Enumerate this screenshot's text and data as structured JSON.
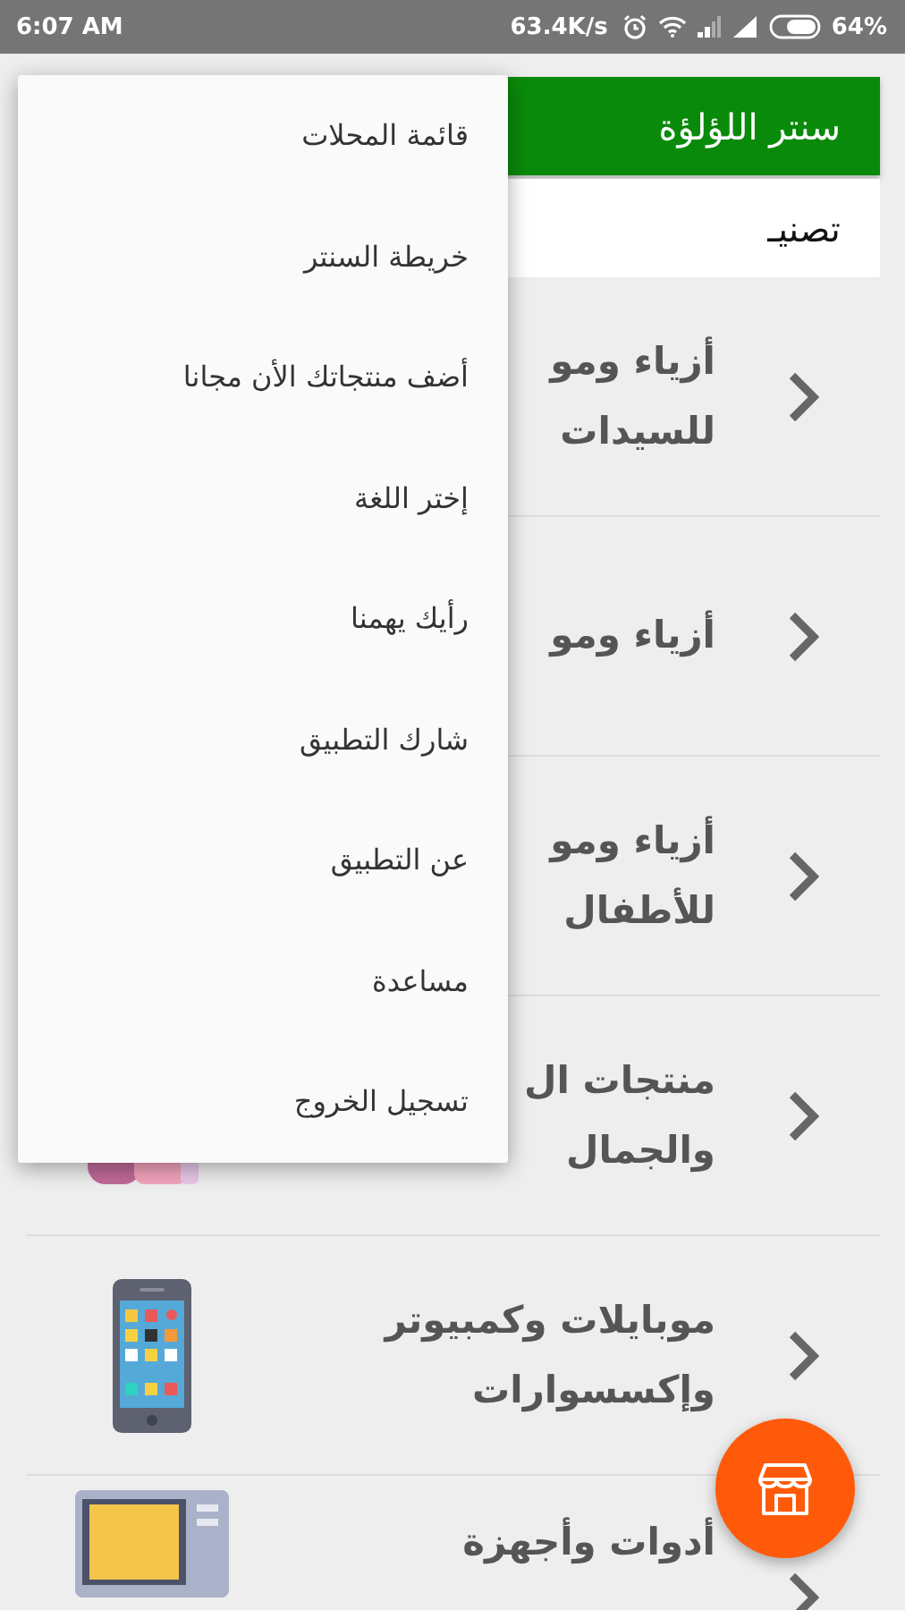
{
  "status_bar": {
    "time": "6:07 AM",
    "speed": "63.4K/s",
    "battery": "64%"
  },
  "app_bar": {
    "title": "سنتر اللؤلؤة"
  },
  "tab_strip": {
    "label": "تصنيـ"
  },
  "categories": [
    {
      "lines": [
        "أزياء ومو",
        "للسيدات"
      ],
      "kind": "none"
    },
    {
      "lines": [
        "أزياء ومو"
      ],
      "kind": "none"
    },
    {
      "lines": [
        "أزياء ومو",
        "للأطفال"
      ],
      "kind": "none"
    },
    {
      "lines": [
        "منتجات ال",
        "والجمال"
      ],
      "kind": "bottles"
    },
    {
      "lines": [
        "موبايلات وكمبيوتر",
        "وإكسسوارات"
      ],
      "kind": "phone"
    },
    {
      "lines": [
        "أدوات وأجهزة"
      ],
      "kind": "microwave"
    }
  ],
  "menu": {
    "items": [
      "قائمة المحلات",
      "خريطة السنتر",
      "أضف منتجاتك الأن مجانا",
      "إختر اللغة",
      "رأيك يهمنا",
      "شارك التطبيق",
      "عن التطبيق",
      "مساعدة",
      "تسجيل الخروج"
    ]
  }
}
